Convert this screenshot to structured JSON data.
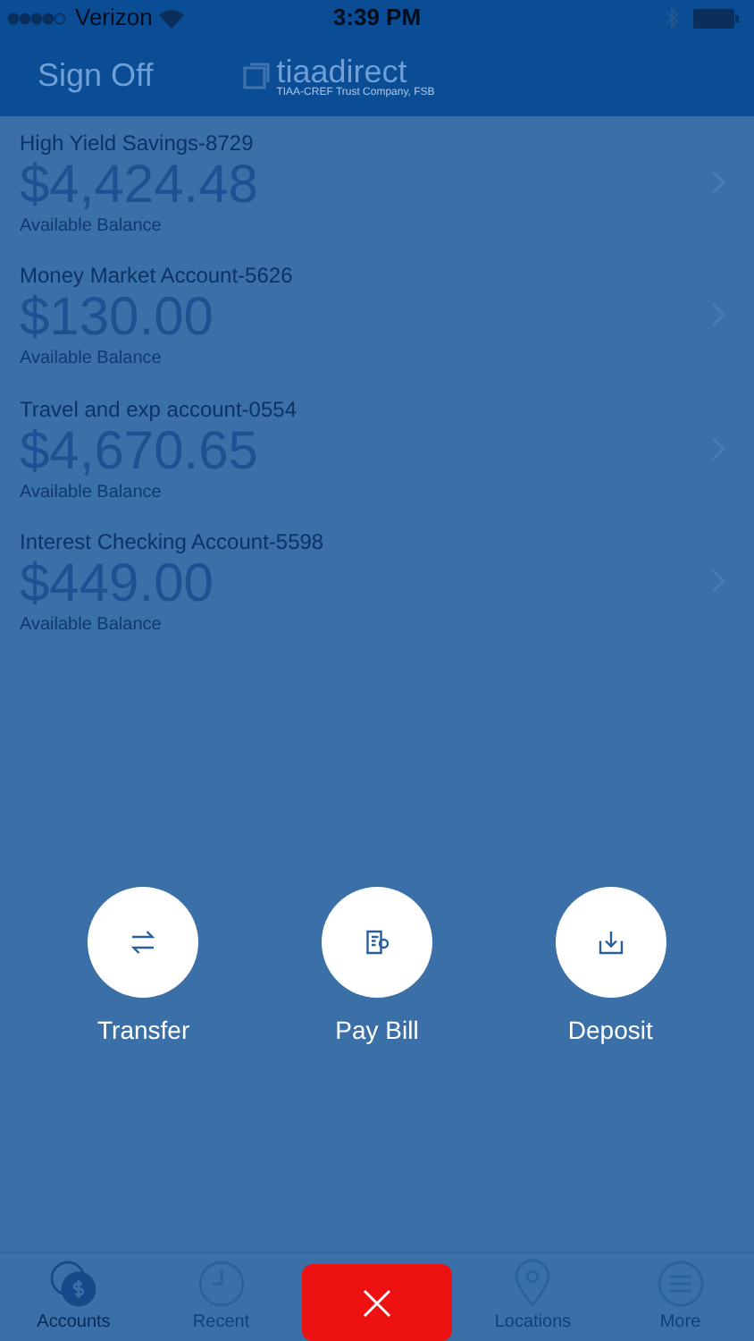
{
  "status_bar": {
    "carrier": "Verizon",
    "time": "3:39 PM"
  },
  "nav": {
    "left": "Sign Off",
    "logo": "tiaadirect",
    "logo_sub": "TIAA-CREF Trust Company, FSB"
  },
  "accounts": [
    {
      "name": "High Yield Savings-8729",
      "balance": "$4,424.48",
      "caption": "Available Balance"
    },
    {
      "name": "Money Market Account-5626",
      "balance": "$130.00",
      "caption": "Available Balance"
    },
    {
      "name": "Travel and exp account-0554",
      "balance": "$4,670.65",
      "caption": "Available Balance"
    },
    {
      "name": "Interest Checking Account-5598",
      "balance": "$449.00",
      "caption": "Available Balance"
    }
  ],
  "actions": [
    {
      "kind": "transfer",
      "label": "Transfer"
    },
    {
      "kind": "bill",
      "label": "Pay Bill"
    },
    {
      "kind": "deposit",
      "label": "Deposit"
    }
  ],
  "tabs": [
    {
      "kind": "accounts",
      "label": "Accounts",
      "selected": true
    },
    {
      "kind": "recent",
      "label": "Recent",
      "selected": false
    },
    {
      "kind": "close"
    },
    {
      "kind": "locations",
      "label": "Locations",
      "selected": false
    },
    {
      "kind": "more",
      "label": "More",
      "selected": false
    }
  ]
}
